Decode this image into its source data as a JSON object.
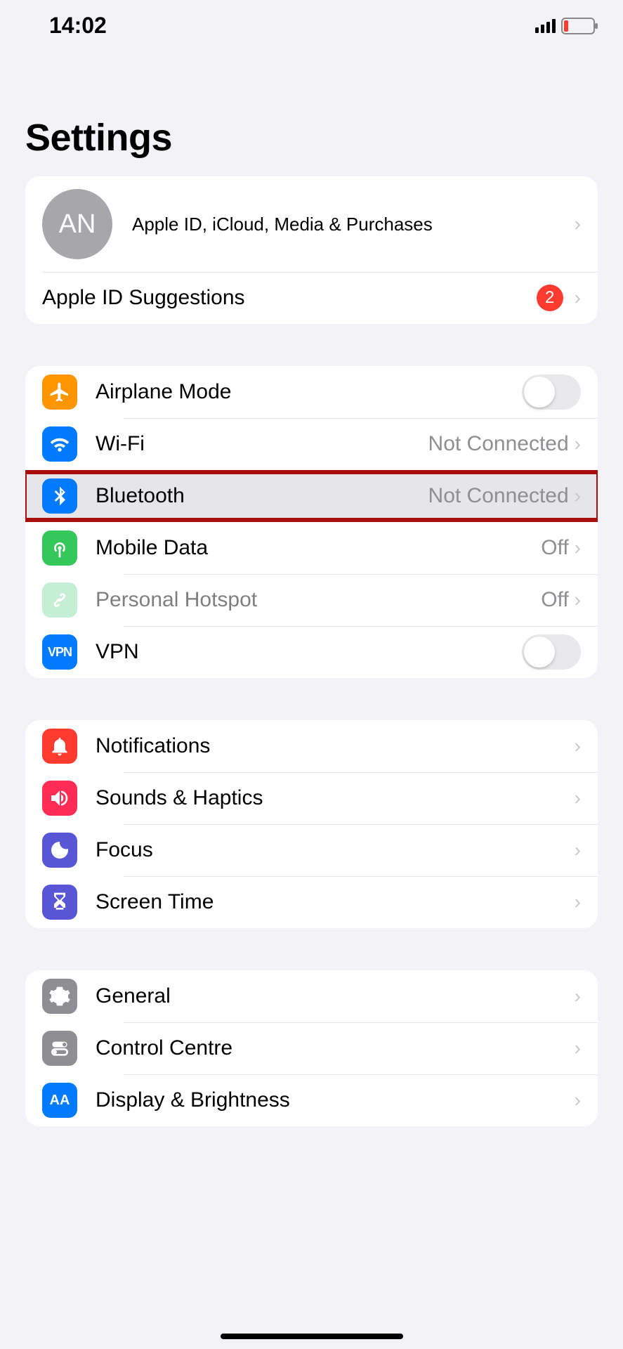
{
  "status": {
    "time": "14:02"
  },
  "title": "Settings",
  "appleid": {
    "avatar_initials": "AN",
    "subtitle": "Apple ID, iCloud, Media & Purchases",
    "suggestions_label": "Apple ID Suggestions",
    "suggestions_count": "2"
  },
  "group_connectivity": {
    "airplane": "Airplane Mode",
    "wifi": "Wi-Fi",
    "wifi_detail": "Not Connected",
    "bluetooth": "Bluetooth",
    "bluetooth_detail": "Not Connected",
    "mobile": "Mobile Data",
    "mobile_detail": "Off",
    "hotspot": "Personal Hotspot",
    "hotspot_detail": "Off",
    "vpn": "VPN",
    "vpn_icon_text": "VPN"
  },
  "group_notify": {
    "notifications": "Notifications",
    "sounds": "Sounds & Haptics",
    "focus": "Focus",
    "screentime": "Screen Time"
  },
  "group_general": {
    "general": "General",
    "control": "Control Centre",
    "display": "Display & Brightness",
    "display_icon_text": "AA"
  }
}
